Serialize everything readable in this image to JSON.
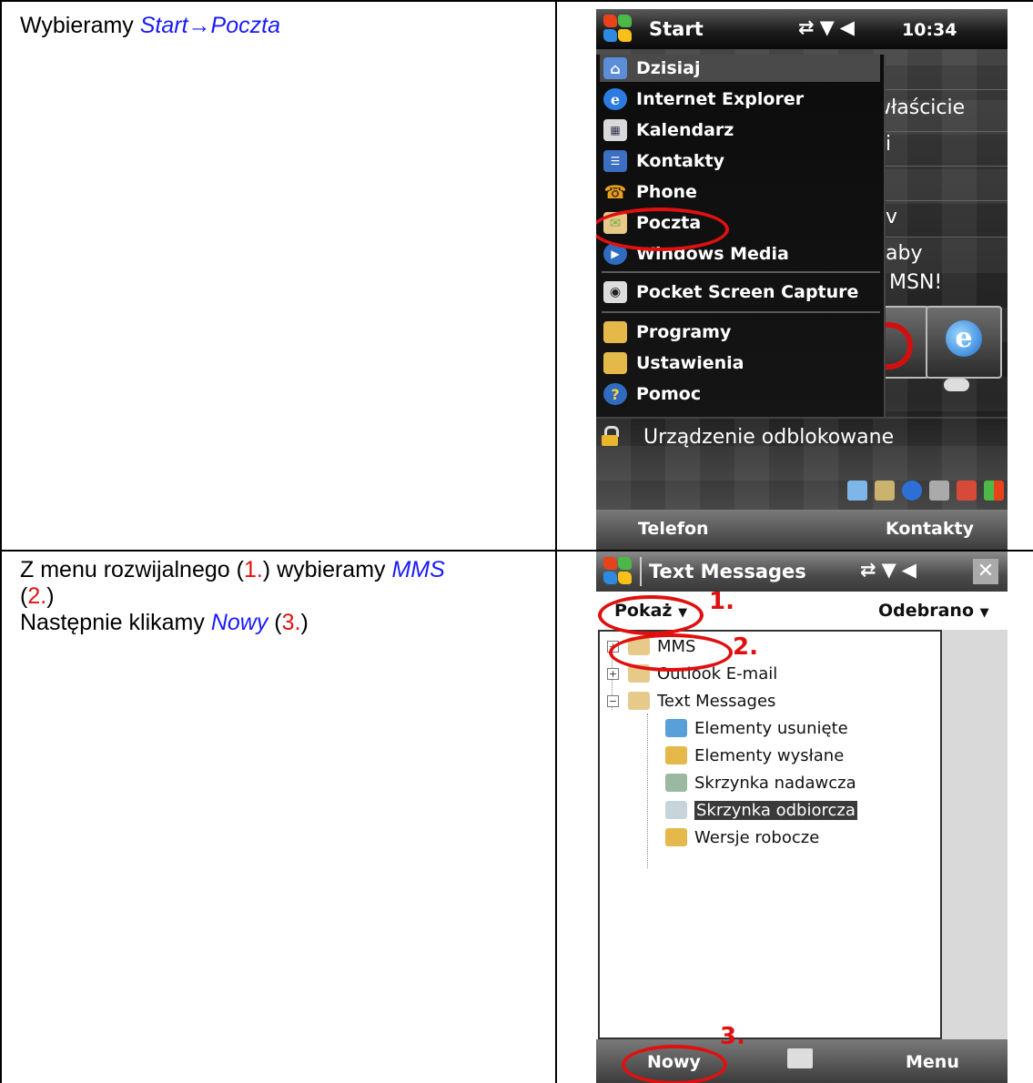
{
  "row1": {
    "instruction": {
      "prefix": "Wybieramy ",
      "link": "Start→Poczta"
    },
    "screen": {
      "title": "Start",
      "time": "10:34",
      "today_lines": [
        "właścicie",
        "i",
        "v",
        "aby",
        "MSN!"
      ],
      "menu_items": [
        {
          "label": "Dzisiaj",
          "icon": "home-icon",
          "selected": true
        },
        {
          "label": "Internet Explorer",
          "icon": "internet-explorer-icon"
        },
        {
          "label": "Kalendarz",
          "icon": "calendar-icon"
        },
        {
          "label": "Kontakty",
          "icon": "contacts-icon"
        },
        {
          "label": "Phone",
          "icon": "phone-icon"
        },
        {
          "label": "Poczta",
          "icon": "mail-icon"
        },
        {
          "label": "Windows Media",
          "icon": "media-player-icon"
        },
        {
          "label": "Pocket Screen Capture",
          "icon": "camera-icon"
        },
        {
          "label": "Programy",
          "icon": "programs-folder-icon"
        },
        {
          "label": "Ustawienia",
          "icon": "settings-folder-icon"
        },
        {
          "label": "Pomoc",
          "icon": "help-icon"
        }
      ],
      "lock_text": "Urządzenie odblokowane",
      "softkeys": {
        "left": "Telefon",
        "right": "Kontakty"
      }
    }
  },
  "row2": {
    "instruction": {
      "line1_prefix": "Z menu rozwijalnego (",
      "n1": "1.",
      "line1_mid": ") wybieramy ",
      "link_mms": "MMS",
      "line2_open": "(",
      "n2": "2.",
      "line2_close": ")",
      "line3_prefix": "Następnie klikamy ",
      "link_nowy": "Nowy",
      "line3_mid": " (",
      "n3": "3.",
      "line3_close": ")"
    },
    "screen": {
      "title": "Text Messages",
      "show_label": "Pokaż",
      "received_label": "Odebrano",
      "tree": [
        {
          "label": "MMS",
          "level": 0,
          "expander": "+"
        },
        {
          "label": "Outlook E-mail",
          "level": 0,
          "expander": "+"
        },
        {
          "label": "Text Messages",
          "level": 0,
          "expander": "−"
        },
        {
          "label": "Elementy usunięte",
          "level": 1
        },
        {
          "label": "Elementy wysłane",
          "level": 1
        },
        {
          "label": "Skrzynka nadawcza",
          "level": 1
        },
        {
          "label": "Skrzynka odbiorcza",
          "level": 1,
          "selected": true
        },
        {
          "label": "Wersje robocze",
          "level": 1
        }
      ],
      "softkeys": {
        "left": "Nowy",
        "right": "Menu"
      },
      "annotations": [
        "1.",
        "2.",
        "3."
      ]
    }
  },
  "colors": {
    "link": "#1a1aff",
    "annotation": "#e01010"
  }
}
